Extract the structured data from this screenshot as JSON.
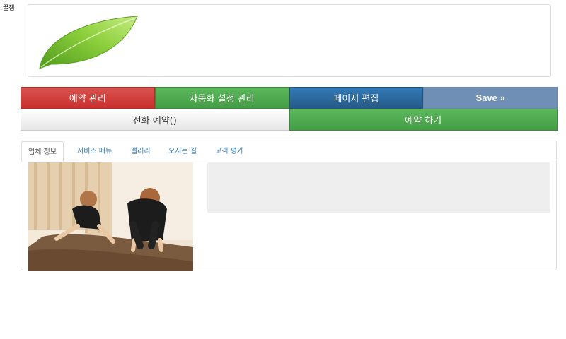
{
  "brand": {
    "name": "꿀잼"
  },
  "logo": {
    "icon": "leaf-icon",
    "colors": {
      "leaf_light": "#b5e36a",
      "leaf_dark": "#4f9a1c"
    }
  },
  "toolbar": {
    "buttons": [
      {
        "label": "예약 관리",
        "color": "#d9534f"
      },
      {
        "label": "자동화 설정 관리",
        "color": "#5cb85c"
      },
      {
        "label": "페이지 편집",
        "color": "#337ab7"
      },
      {
        "label": "Save »",
        "color": "#6f8fb5"
      }
    ],
    "phone_label": "전화 예약()",
    "reserve_label": "예약 하기"
  },
  "tabs": [
    {
      "label": "업체 정보",
      "active": true
    },
    {
      "label": "서비스 메뉴"
    },
    {
      "label": "갤러리"
    },
    {
      "label": "오시는 길"
    },
    {
      "label": "고객 평가"
    }
  ],
  "content": {
    "photo": "massage-photo",
    "info_box_color": "#eeeeee"
  }
}
